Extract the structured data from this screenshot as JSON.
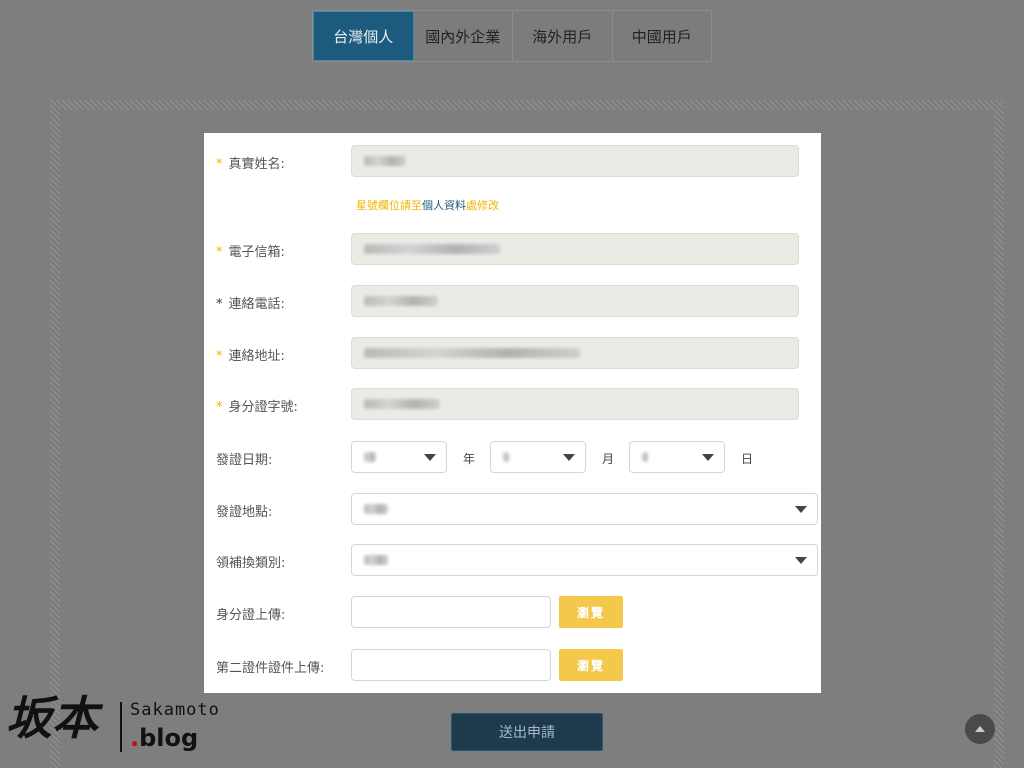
{
  "tabs": [
    {
      "label": "台灣個人",
      "active": true
    },
    {
      "label": "國內外企業",
      "active": false
    },
    {
      "label": "海外用戶",
      "active": false
    },
    {
      "label": "中國用戶",
      "active": false
    }
  ],
  "form": {
    "required_mark": "*",
    "name_label": "真實姓名:",
    "hint_prefix": "星號欄位請至",
    "hint_link": "個人資料",
    "hint_suffix": "處修改",
    "email_label": "電子信箱:",
    "phone_label": "連絡電話:",
    "address_label": "連絡地址:",
    "id_label": "身分證字號:",
    "issue_date_label": "發證日期:",
    "year_unit": "年",
    "month_unit": "月",
    "day_unit": "日",
    "issue_place_label": "發證地點:",
    "issue_type_label": "領補換類別:",
    "id_upload_label": "身分證上傳:",
    "second_doc_label": "第二證件證件上傳:",
    "browse_label": "瀏覽"
  },
  "submit_label": "送出申請",
  "logo": {
    "kanji": "坂本",
    "name": "Sakamoto",
    "dot": ".",
    "blog": "blog"
  },
  "colors": {
    "accent": "#1d5b7e",
    "required_star": "#f0b400",
    "browse_button": "#f4c84a"
  }
}
